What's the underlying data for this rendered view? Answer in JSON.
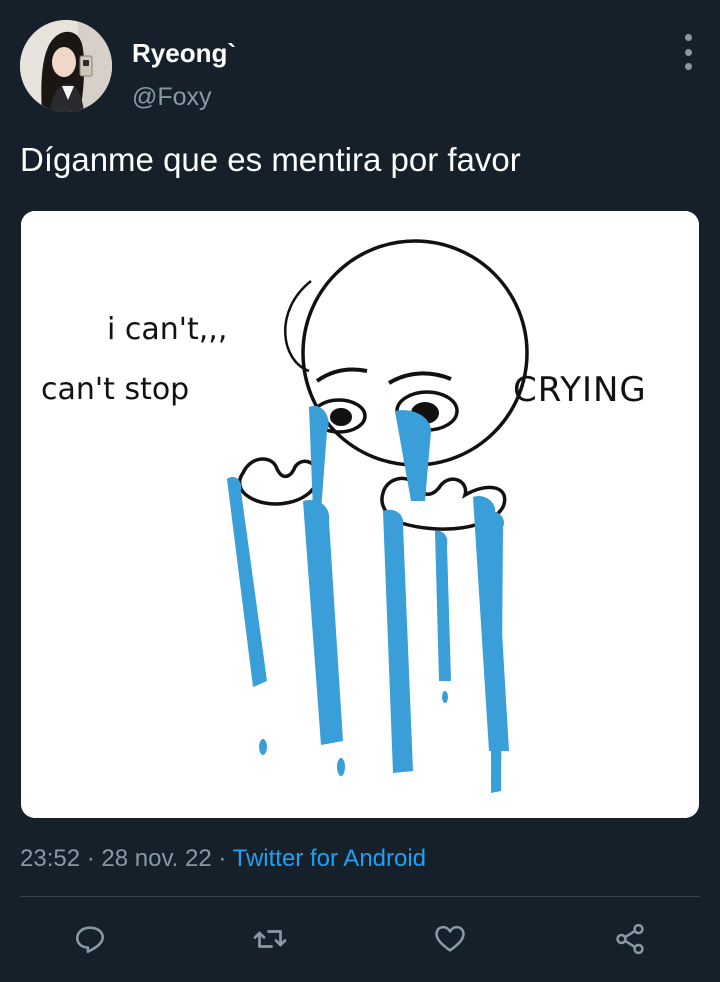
{
  "tweet": {
    "display_name": "Ryeong`",
    "handle": "@Foxy",
    "text": "Díganme que es mentira por favor",
    "time": "23:52",
    "separator": " · ",
    "date": "28 nov. 22",
    "source": "Twitter for Android"
  },
  "media": {
    "caption_line1": "i can't,,,",
    "caption_line2": "can't stop",
    "caption_line3": "CRYING"
  },
  "icons": {
    "more": "more-vertical-icon",
    "reply": "reply-icon",
    "retweet": "retweet-icon",
    "like": "heart-icon",
    "share": "share-icon"
  },
  "colors": {
    "background": "#15202b",
    "secondary_text": "#8899a6",
    "accent": "#1da1f2",
    "tears": "#3a9fd8"
  }
}
